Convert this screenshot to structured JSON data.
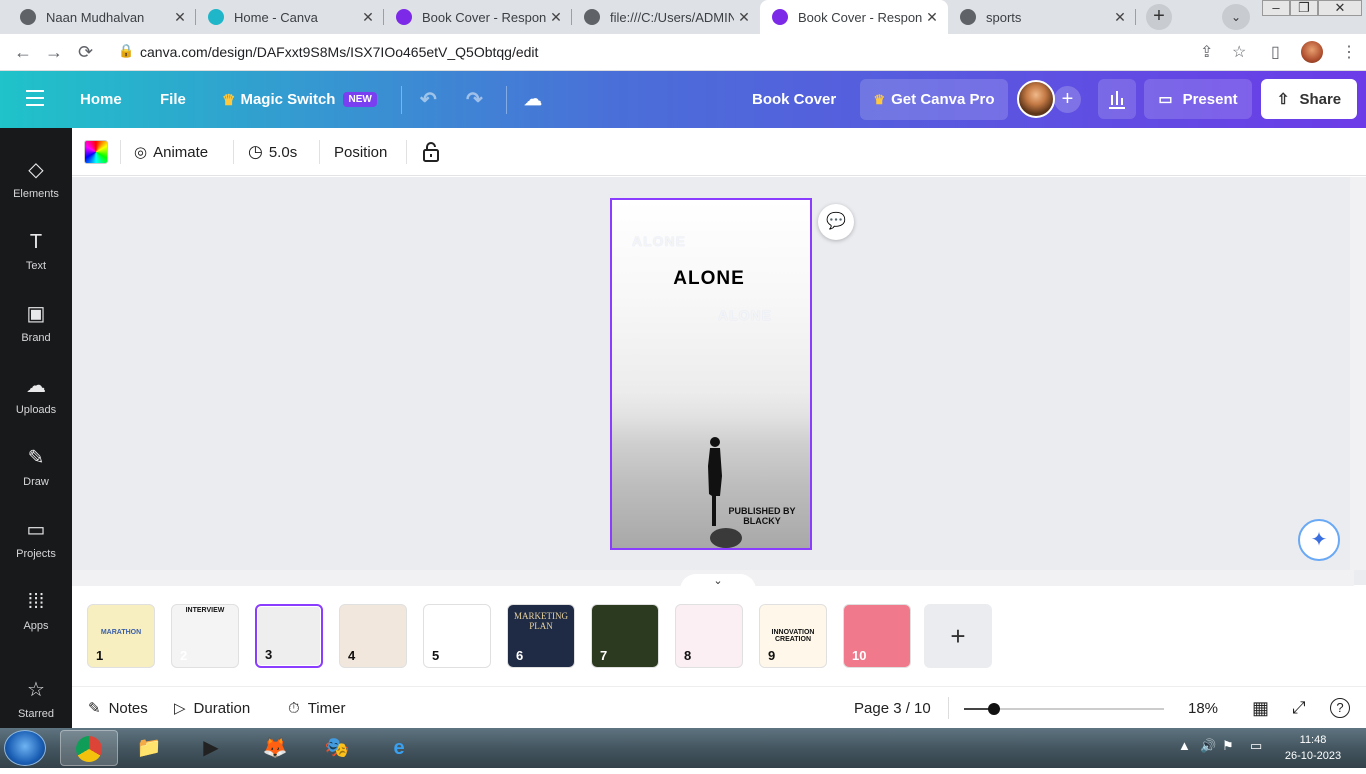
{
  "browser": {
    "tabs": [
      {
        "title": "Naan Mudhalvan",
        "favicon_color": "#5f6368",
        "active": false
      },
      {
        "title": "Home - Canva",
        "favicon_color": "#1fb6c9",
        "active": false
      },
      {
        "title": "Book Cover - Responsiv",
        "favicon_color": "#7d2ae8",
        "active": false
      },
      {
        "title": "file:///C:/Users/ADMIN/",
        "favicon_color": "#5f6368",
        "active": false
      },
      {
        "title": "Book Cover - Responsiv",
        "favicon_color": "#7d2ae8",
        "active": true
      },
      {
        "title": "sports",
        "favicon_color": "#5f6368",
        "active": false
      }
    ],
    "url": "canva.com/design/DAFxxt9S8Ms/ISX7IOo465etV_Q5Obtqg/edit"
  },
  "header": {
    "home_label": "Home",
    "file_label": "File",
    "magic_switch_label": "Magic Switch",
    "new_badge": "NEW",
    "design_title": "Book Cover",
    "get_pro_label": "Get Canva Pro",
    "present_label": "Present",
    "share_label": "Share",
    "accent": "#7d2ae8",
    "gradient_start": "#1fc3c9",
    "gradient_end": "#6c3be8"
  },
  "rail": [
    {
      "label": "Elements",
      "icon": "elements-icon"
    },
    {
      "label": "Text",
      "icon": "text-icon"
    },
    {
      "label": "Brand",
      "icon": "brand-icon"
    },
    {
      "label": "Uploads",
      "icon": "uploads-icon"
    },
    {
      "label": "Draw",
      "icon": "draw-icon"
    },
    {
      "label": "Projects",
      "icon": "projects-icon"
    },
    {
      "label": "Apps",
      "icon": "apps-icon"
    },
    {
      "label": "Starred",
      "icon": "star-icon"
    }
  ],
  "toolbar": {
    "animate_label": "Animate",
    "duration_label": "5.0s",
    "position_label": "Position"
  },
  "page": {
    "ghost_text_1": "ALONE",
    "title": "ALONE",
    "ghost_text_2": "ALONE",
    "published_line1": "PUBLISHED BY",
    "published_line2": "BLACKY"
  },
  "thumbnails": [
    {
      "num": "1",
      "bg": "#f8efc0",
      "label": "MARATHON",
      "label_color": "#3a5fa8"
    },
    {
      "num": "2",
      "bg": "#f4f4f4",
      "label": "INTERVIEW",
      "label_color": "#111"
    },
    {
      "num": "3",
      "bg": "#eeeeee",
      "label": "",
      "label_color": "#111"
    },
    {
      "num": "4",
      "bg": "#f2e7dc",
      "label": "",
      "label_color": "#b99"
    },
    {
      "num": "5",
      "bg": "#ffffff",
      "label": "",
      "label_color": "#c33"
    },
    {
      "num": "6",
      "bg": "#1f2a44",
      "label": "MARKETING PLAN",
      "label_color": "#e8d3a0"
    },
    {
      "num": "7",
      "bg": "#2c3a1f",
      "label": "",
      "label_color": "#fff"
    },
    {
      "num": "8",
      "bg": "#fbeff3",
      "label": "",
      "label_color": "#e68"
    },
    {
      "num": "9",
      "bg": "#fff8ea",
      "label": "INNOVATION CREATION",
      "label_color": "#111"
    },
    {
      "num": "10",
      "bg": "#f07a8c",
      "label": "",
      "label_color": "#fff"
    }
  ],
  "footer": {
    "notes_label": "Notes",
    "duration_label": "Duration",
    "timer_label": "Timer",
    "page_indicator": "Page 3 / 10",
    "zoom_label": "18%",
    "zoom_fraction": 0.15
  },
  "taskbar": {
    "time": "11:48",
    "date": "26-10-2023"
  }
}
